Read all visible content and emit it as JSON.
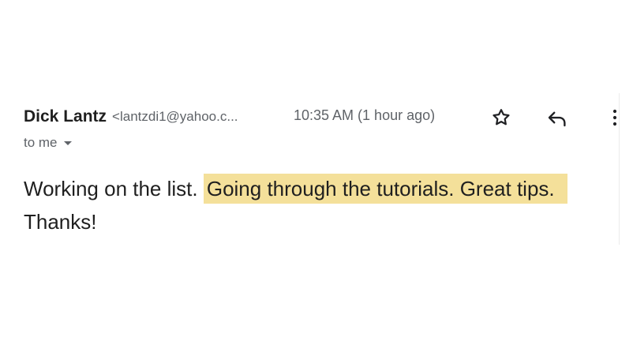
{
  "message": {
    "sender_name": "Dick Lantz",
    "sender_email": "<lantzdi1@yahoo.c...",
    "timestamp": "10:35 AM (1 hour ago)",
    "recipient_label": "to me",
    "body_plain": "Working on the list. ",
    "body_highlighted": "Going through the tutorials. Great tips.",
    "body_closing": "Thanks!"
  },
  "icons": {
    "star": "star-icon",
    "reply": "reply-icon",
    "more": "more-vertical-icon",
    "recipient_dropdown": "caret-down-icon"
  },
  "colors": {
    "highlight": "#f4e09a",
    "secondary_text": "#5f6368",
    "primary_text": "#1f1f1f"
  }
}
